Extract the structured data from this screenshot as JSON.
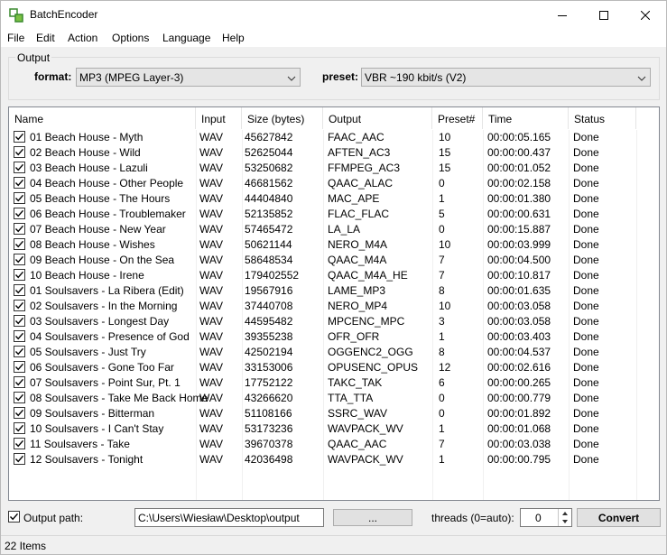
{
  "app": {
    "title": "BatchEncoder"
  },
  "menu": [
    "File",
    "Edit",
    "Action",
    "Options",
    "Language",
    "Help"
  ],
  "output_group": {
    "label": "Output",
    "format_label": "format:",
    "format_value": "MP3 (MPEG Layer-3)",
    "preset_label": "preset:",
    "preset_value": "VBR ~190 kbit/s (V2)"
  },
  "table": {
    "columns": [
      "Name",
      "Input",
      "Size (bytes)",
      "Output",
      "Preset#",
      "Time",
      "Status"
    ],
    "rows": [
      {
        "name": "01 Beach House - Myth",
        "input": "WAV",
        "size": "45627842",
        "output": "FAAC_AAC",
        "preset": "10",
        "time": "00:00:05.165",
        "status": "Done",
        "checked": true
      },
      {
        "name": "02 Beach House - Wild",
        "input": "WAV",
        "size": "52625044",
        "output": "AFTEN_AC3",
        "preset": "15",
        "time": "00:00:00.437",
        "status": "Done",
        "checked": true
      },
      {
        "name": "03 Beach House - Lazuli",
        "input": "WAV",
        "size": "53250682",
        "output": "FFMPEG_AC3",
        "preset": "15",
        "time": "00:00:01.052",
        "status": "Done",
        "checked": true
      },
      {
        "name": "04 Beach House - Other People",
        "input": "WAV",
        "size": "46681562",
        "output": "QAAC_ALAC",
        "preset": "0",
        "time": "00:00:02.158",
        "status": "Done",
        "checked": true
      },
      {
        "name": "05 Beach House - The Hours",
        "input": "WAV",
        "size": "44404840",
        "output": "MAC_APE",
        "preset": "1",
        "time": "00:00:01.380",
        "status": "Done",
        "checked": true
      },
      {
        "name": "06 Beach House - Troublemaker",
        "input": "WAV",
        "size": "52135852",
        "output": "FLAC_FLAC",
        "preset": "5",
        "time": "00:00:00.631",
        "status": "Done",
        "checked": true
      },
      {
        "name": "07 Beach House - New Year",
        "input": "WAV",
        "size": "57465472",
        "output": "LA_LA",
        "preset": "0",
        "time": "00:00:15.887",
        "status": "Done",
        "checked": true
      },
      {
        "name": "08 Beach House - Wishes",
        "input": "WAV",
        "size": "50621144",
        "output": "NERO_M4A",
        "preset": "10",
        "time": "00:00:03.999",
        "status": "Done",
        "checked": true
      },
      {
        "name": "09 Beach House - On the Sea",
        "input": "WAV",
        "size": "58648534",
        "output": "QAAC_M4A",
        "preset": "7",
        "time": "00:00:04.500",
        "status": "Done",
        "checked": true
      },
      {
        "name": "10 Beach House - Irene",
        "input": "WAV",
        "size": "179402552",
        "output": "QAAC_M4A_HE",
        "preset": "7",
        "time": "00:00:10.817",
        "status": "Done",
        "checked": true
      },
      {
        "name": "01 Soulsavers - La Ribera (Edit)",
        "input": "WAV",
        "size": "19567916",
        "output": "LAME_MP3",
        "preset": "8",
        "time": "00:00:01.635",
        "status": "Done",
        "checked": true
      },
      {
        "name": "02 Soulsavers - In the Morning",
        "input": "WAV",
        "size": "37440708",
        "output": "NERO_MP4",
        "preset": "10",
        "time": "00:00:03.058",
        "status": "Done",
        "checked": true
      },
      {
        "name": "03 Soulsavers - Longest Day",
        "input": "WAV",
        "size": "44595482",
        "output": "MPCENC_MPC",
        "preset": "3",
        "time": "00:00:03.058",
        "status": "Done",
        "checked": true
      },
      {
        "name": "04 Soulsavers - Presence of God",
        "input": "WAV",
        "size": "39355238",
        "output": "OFR_OFR",
        "preset": "1",
        "time": "00:00:03.403",
        "status": "Done",
        "checked": true
      },
      {
        "name": "05 Soulsavers - Just Try",
        "input": "WAV",
        "size": "42502194",
        "output": "OGGENC2_OGG",
        "preset": "8",
        "time": "00:00:04.537",
        "status": "Done",
        "checked": true
      },
      {
        "name": "06 Soulsavers - Gone Too Far",
        "input": "WAV",
        "size": "33153006",
        "output": "OPUSENC_OPUS",
        "preset": "12",
        "time": "00:00:02.616",
        "status": "Done",
        "checked": true
      },
      {
        "name": "07 Soulsavers - Point Sur, Pt. 1",
        "input": "WAV",
        "size": "17752122",
        "output": "TAKC_TAK",
        "preset": "6",
        "time": "00:00:00.265",
        "status": "Done",
        "checked": true
      },
      {
        "name": "08 Soulsavers - Take Me Back Home",
        "input": "WAV",
        "size": "43266620",
        "output": "TTA_TTA",
        "preset": "0",
        "time": "00:00:00.779",
        "status": "Done",
        "checked": true
      },
      {
        "name": "09 Soulsavers - Bitterman",
        "input": "WAV",
        "size": "51108166",
        "output": "SSRC_WAV",
        "preset": "0",
        "time": "00:00:01.892",
        "status": "Done",
        "checked": true
      },
      {
        "name": "10 Soulsavers - I Can't Stay",
        "input": "WAV",
        "size": "53173236",
        "output": "WAVPACK_WV",
        "preset": "1",
        "time": "00:00:01.068",
        "status": "Done",
        "checked": true
      },
      {
        "name": "11 Soulsavers - Take",
        "input": "WAV",
        "size": "39670378",
        "output": "QAAC_AAC",
        "preset": "7",
        "time": "00:00:03.038",
        "status": "Done",
        "checked": true
      },
      {
        "name": "12 Soulsavers - Tonight",
        "input": "WAV",
        "size": "42036498",
        "output": "WAVPACK_WV",
        "preset": "1",
        "time": "00:00:00.795",
        "status": "Done",
        "checked": true
      }
    ]
  },
  "bottom": {
    "output_path_label": "Output path:",
    "output_path_checked": true,
    "output_path_value": "C:\\Users\\Wiesław\\Desktop\\output",
    "browse_label": "...",
    "threads_label": "threads (0=auto):",
    "threads_value": "0",
    "convert_label": "Convert"
  },
  "status": {
    "items": "22 Items"
  },
  "icons": {
    "app": "batchencoder-app-icon",
    "minimize": "minimize-icon",
    "maximize": "maximize-icon",
    "close": "close-icon",
    "dropdown": "chevron-down-icon",
    "check": "checkmark-icon"
  }
}
